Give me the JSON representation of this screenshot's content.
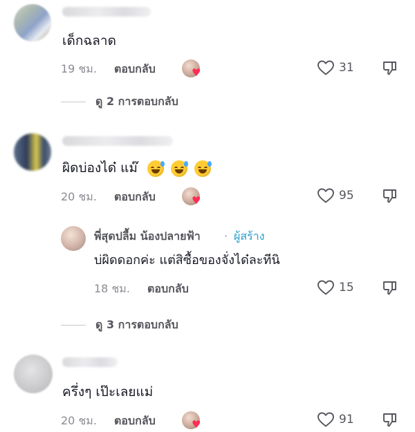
{
  "comments": [
    {
      "text": "เด็กฉลาด",
      "time": "19 ชม.",
      "reply_label": "ตอบกลับ",
      "likes": "31",
      "view_replies": "ดู 2 การตอบกลับ"
    },
    {
      "text": "ผิดบ่องได๋ แม๊",
      "time": "20 ชม.",
      "reply_label": "ตอบกลับ",
      "likes": "95",
      "view_replies": "ดู 3 การตอบกลับ"
    },
    {
      "text": "ครึ่งๆ เป๊ะเลยแม่",
      "time": "20 ชม.",
      "reply_label": "ตอบกลับ",
      "likes": "91"
    }
  ],
  "creator_reply": {
    "name": "พี่สุดปลื้ม น้องปลายฟ้า",
    "separator": "·",
    "badge": "ผู้สร้าง",
    "text": "บ่ผิดดอกค่ะ แต่สิซื้อของจั่งได๋ละทีนิ",
    "time": "18 ชม.",
    "reply_label": "ตอบกลับ",
    "likes": "15"
  },
  "icons": {
    "like": "heart-outline-icon",
    "dislike": "thumbs-down-icon",
    "emoji": "grinning-sweat-emoji",
    "creator_liked": "creator-heart-badge"
  },
  "colors": {
    "text": "#161823",
    "muted": "#8a8b91",
    "creator_badge": "#2a9fc9",
    "heart": "#fe2c55"
  }
}
